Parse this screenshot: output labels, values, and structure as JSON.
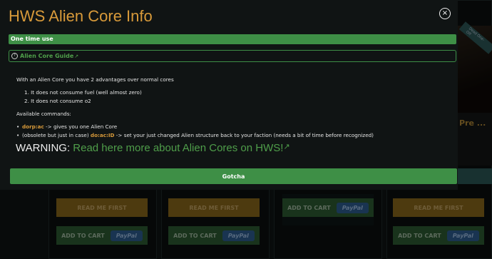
{
  "modal": {
    "title": "HWS Alien Core Info",
    "close_icon": "×",
    "badge": "One time use",
    "guide_link": "Alien Core Guide",
    "intro": "With an Alien Core you have 2 advantages over normal cores",
    "advantages": [
      "1. It does not consume fuel (well almost zero)",
      "2. It does not consume o2"
    ],
    "commands_heading": "Available commands:",
    "commands": [
      {
        "prefix": "",
        "cmd": "dorp:ac",
        "text": " -> gives you one Alien Core"
      },
      {
        "prefix": "(obsolete but just in case) ",
        "cmd": "do:ac:ID",
        "text": " -> set your just changed Alien structure back to your faction (needs a bit of time before recognized)"
      }
    ],
    "warning_label": "WARNING: ",
    "warning_link": "Read here more about Alien Cores on HWS!",
    "gotcha": "Gotcha"
  },
  "background": {
    "read_me_label": "READ ME FIRST",
    "add_to_cart_label": "ADD TO CART",
    "paypal_label": "PayPal",
    "side_ribbon": "Dead One-Off",
    "side_title": "Pre ..."
  },
  "colors": {
    "accent_orange": "#d89a3a",
    "accent_green": "#3e8f46",
    "link_green": "#4f9e4a"
  }
}
